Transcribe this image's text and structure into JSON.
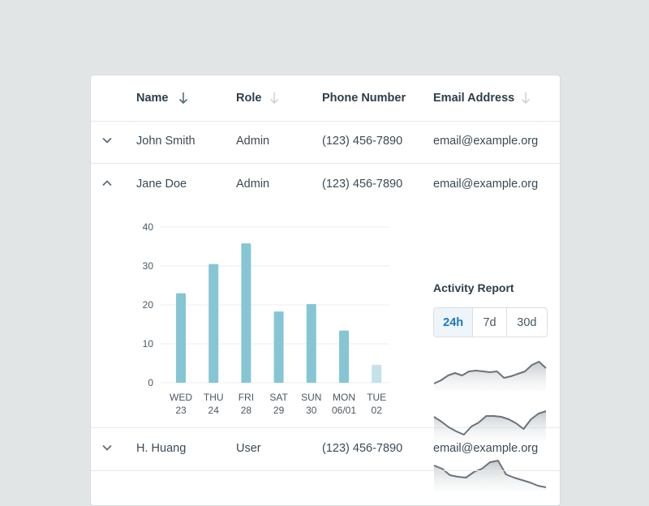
{
  "table": {
    "headers": {
      "name": "Name",
      "role": "Role",
      "phone": "Phone Number",
      "email": "Email Address"
    },
    "rows": [
      {
        "name": "John Smith",
        "role": "Admin",
        "phone": "(123) 456-7890",
        "email": "email@example.org",
        "expanded": false
      },
      {
        "name": "Jane Doe",
        "role": "Admin",
        "phone": "(123) 456-7890",
        "email": "email@example.org",
        "expanded": true
      },
      {
        "name": "H. Huang",
        "role": "User",
        "phone": "(123) 456-7890",
        "email": "email@example.org",
        "expanded": false
      }
    ]
  },
  "activity_report": {
    "title": "Activity Report",
    "ranges": [
      "24h",
      "7d",
      "30d"
    ],
    "selected": "24h"
  },
  "chart_data": {
    "type": "bar",
    "categories": [
      [
        "WED",
        "23"
      ],
      [
        "THU",
        "24"
      ],
      [
        "FRI",
        "28"
      ],
      [
        "SAT",
        "29"
      ],
      [
        "SUN",
        "30"
      ],
      [
        "MON",
        "06/01"
      ],
      [
        "TUE",
        "02"
      ]
    ],
    "values": [
      23,
      30.5,
      35.8,
      18.3,
      20.2,
      13.4,
      4.6
    ],
    "ylim": [
      0,
      40
    ],
    "yticks": [
      0,
      10,
      20,
      30,
      40
    ],
    "grid": true,
    "colors": {
      "bar": "#86c6d4",
      "bar_last": "#c4e2e8",
      "grid": "#e8ecef",
      "axis_text": "#4a5863"
    }
  },
  "sparklines": [
    {
      "values": [
        5,
        9,
        15,
        18,
        15,
        20,
        21,
        20,
        19,
        20,
        12,
        14,
        17,
        20,
        28,
        32,
        24
      ]
    },
    {
      "values": [
        26,
        20,
        13,
        8,
        4,
        14,
        19,
        27,
        27,
        26,
        23,
        18,
        11,
        23,
        30,
        33
      ]
    },
    {
      "values": [
        28,
        24,
        16,
        14,
        13,
        20,
        24,
        32,
        34,
        17,
        13,
        10,
        7,
        3,
        1
      ]
    }
  ],
  "colors": {
    "accent": "#1a78c2",
    "spark_line": "#6b737a"
  },
  "icons": {
    "expand": "chevron-down-icon",
    "collapse": "chevron-up-icon",
    "sort": "arrow-down-icon"
  }
}
